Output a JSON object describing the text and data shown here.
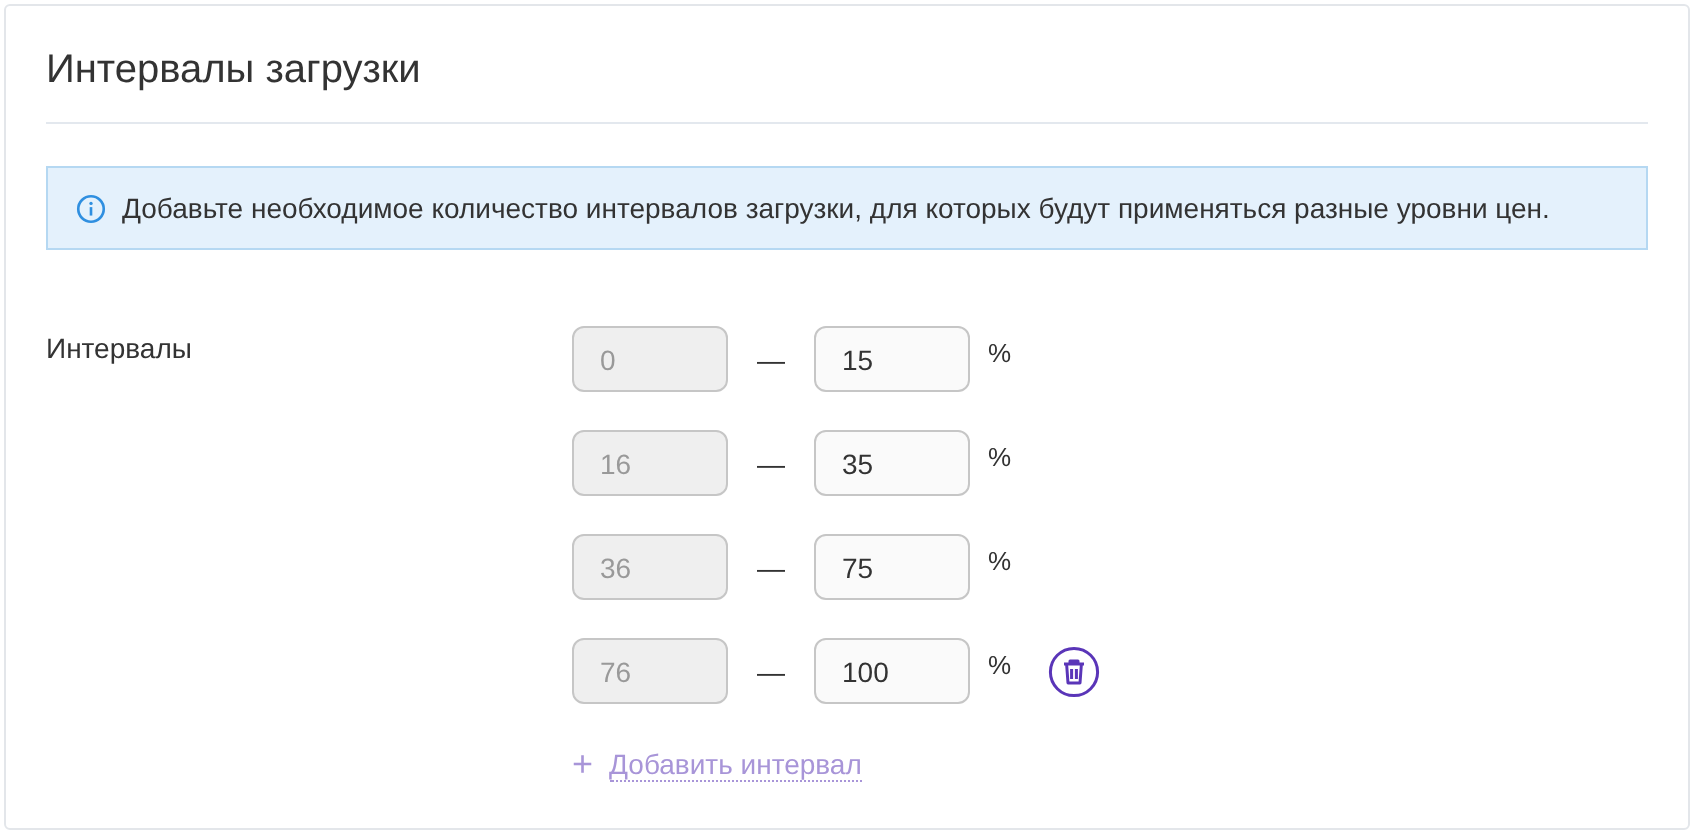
{
  "title": "Интервалы загрузки",
  "info": "Добавьте необходимое количество интервалов загрузки, для которых будут применяться разные уровни цен.",
  "intervals_label": "Интервалы",
  "intervals": [
    {
      "from": "0",
      "from_disabled": true,
      "separator": "—",
      "to": "15",
      "to_disabled": false,
      "unit": "%",
      "deletable": false
    },
    {
      "from": "16",
      "from_disabled": true,
      "separator": "—",
      "to": "35",
      "to_disabled": false,
      "unit": "%",
      "deletable": false
    },
    {
      "from": "36",
      "from_disabled": true,
      "separator": "—",
      "to": "75",
      "to_disabled": false,
      "unit": "%",
      "deletable": false
    },
    {
      "from": "76",
      "from_disabled": true,
      "separator": "—",
      "to": "100",
      "to_disabled": false,
      "unit": "%",
      "deletable": true
    }
  ],
  "add_button": {
    "icon": "+",
    "label": "Добавить интервал"
  }
}
